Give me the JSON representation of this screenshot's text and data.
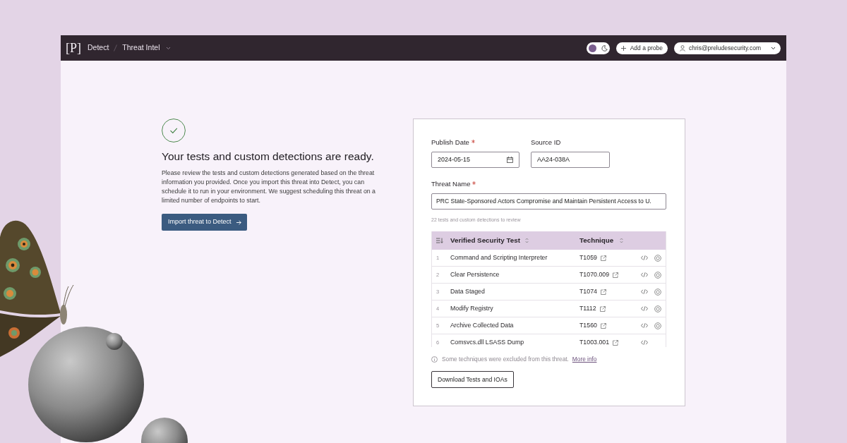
{
  "topbar": {
    "logo": "[P]",
    "breadcrumbs": [
      {
        "label": "Detect"
      },
      {
        "label": "Threat Intel"
      }
    ],
    "theme_toggle": {
      "on": false
    },
    "add_probe": "Add a probe",
    "user": "chris@preludesecurity.com"
  },
  "intro": {
    "heading": "Your tests and custom detections are ready.",
    "body": "Please review the tests and custom detections generated based on the threat information you provided. Once you import this threat into Detect, you can schedule it to run in your environment. We suggest scheduling this threat on a limited number of endpoints to start.",
    "import_button": "Import threat to Detect"
  },
  "form": {
    "publish_date": {
      "label": "Publish Date",
      "required": true,
      "value": "2024-05-15"
    },
    "source_id": {
      "label": "Source ID",
      "required": false,
      "value": "AA24-038A"
    },
    "threat_name": {
      "label": "Threat Name",
      "required": true,
      "value": "PRC State-Sponsored Actors Compromise and Maintain Persistent Access to U."
    },
    "count_note": "22 tests and custom detections to review",
    "table": {
      "columns": [
        {
          "label": "Verified Security Test"
        },
        {
          "label": "Technique"
        }
      ],
      "rows": [
        {
          "index": "1",
          "test": "Command and Scripting Interpreter",
          "technique": "T1059",
          "detection": true
        },
        {
          "index": "2",
          "test": "Clear Persistence",
          "technique": "T1070.009",
          "detection": true
        },
        {
          "index": "3",
          "test": "Data Staged",
          "technique": "T1074",
          "detection": true
        },
        {
          "index": "4",
          "test": "Modify Registry",
          "technique": "T1112",
          "detection": true
        },
        {
          "index": "5",
          "test": "Archive Collected Data",
          "technique": "T1560",
          "detection": true
        },
        {
          "index": "6",
          "test": "Comsvcs.dll LSASS Dump",
          "technique": "T1003.001",
          "detection": false
        }
      ]
    },
    "notice": {
      "text": "Some techniques were excluded from this threat.",
      "link": "More info"
    },
    "download_button": "Download Tests and IOAs"
  }
}
